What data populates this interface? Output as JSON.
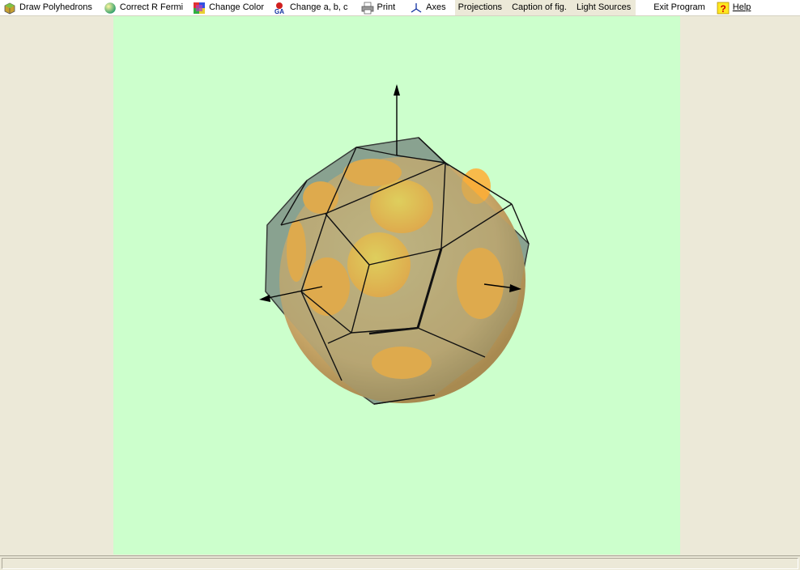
{
  "menu": {
    "draw": {
      "label": "Draw  Polyhedrons",
      "icon": "polyhedron-icon"
    },
    "fermi": {
      "label": "Correct R Fermi",
      "icon": "sphere-icon"
    },
    "color": {
      "label": "Change Color",
      "icon": "palette-icon"
    },
    "abc": {
      "label": "Change   a, b, c",
      "icon": "lattice-icon"
    },
    "print": {
      "label": "Print",
      "icon": "printer-icon"
    },
    "axes": {
      "label": "Axes",
      "icon": "axes-icon"
    },
    "projections": {
      "label": "Projections"
    },
    "caption": {
      "label": "Caption of fig."
    },
    "light": {
      "label": "Light Sources"
    },
    "exit": {
      "label": "Exit Program"
    },
    "help": {
      "label": "Help",
      "icon": "help-icon"
    }
  },
  "colors": {
    "canvas_bg": "#ccffcc",
    "polyhedron_face": "#8aa390",
    "sphere": "#c9a768",
    "spot": "#ffae34",
    "edge": "#111111"
  },
  "status": {
    "text": ""
  }
}
